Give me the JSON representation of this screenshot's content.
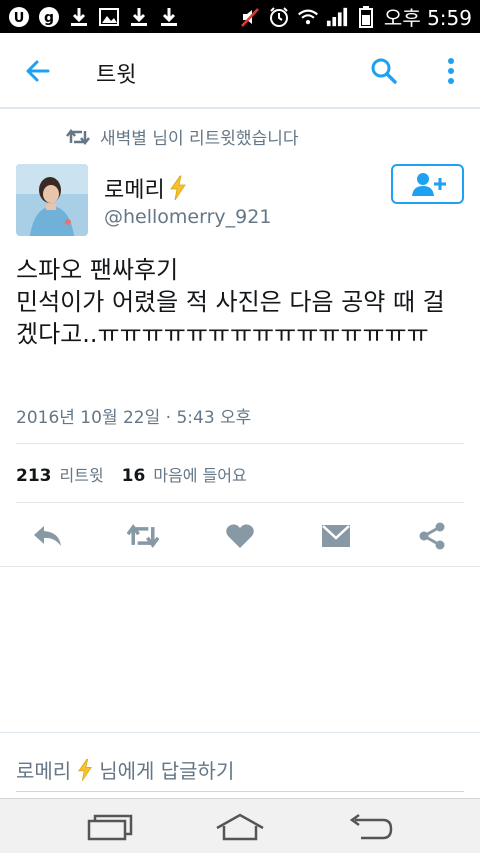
{
  "status_bar": {
    "time": "오후 5:59"
  },
  "app_bar": {
    "title": "트윗"
  },
  "retweet_header": {
    "text": "새벽별 님이 리트윗했습니다"
  },
  "author": {
    "display_name": "로메리",
    "handle": "@hellomerry_921"
  },
  "tweet": {
    "text_line1": "스파오 팬싸후기",
    "text_line2": "민석이가 어렸을 적 사진은 다음 공약 때 걸겠다고..ㅠㅠㅠㅠㅠㅠㅠㅠㅠㅠㅠㅠㅠㅠㅠ",
    "timestamp": "2016년 10월 22일 · 5:43 오후"
  },
  "stats": {
    "retweet_count": "213",
    "retweet_label": "리트윗",
    "like_count": "16",
    "like_label": "마음에 들어요"
  },
  "reply": {
    "name": "로메리",
    "suffix": "님에게 답글하기"
  },
  "colors": {
    "accent": "#1da1f2",
    "secondary_text": "#657786",
    "action_icon": "#8899a6"
  },
  "icons": {
    "lightning": "lightning-icon",
    "retweet": "retweet-icon",
    "follow": "follow-user-icon"
  }
}
